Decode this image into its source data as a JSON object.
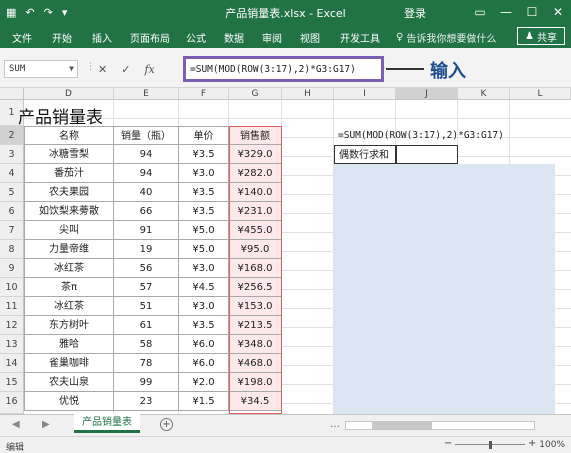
{
  "window": {
    "title": "产品销量表.xlsx - Excel",
    "login": "登录",
    "qat": [
      "▦",
      "↶",
      "↷",
      "▾"
    ],
    "controls": [
      "▭",
      "—",
      "☐",
      "✕"
    ]
  },
  "ribbon": {
    "tabs": [
      "文件",
      "开始",
      "插入",
      "页面布局",
      "公式",
      "数据",
      "审阅",
      "视图",
      "开发工具"
    ],
    "tell_me": "告诉我你想要做什么",
    "share": "共享"
  },
  "formula_bar": {
    "name_box": "SUM",
    "cancel": "✕",
    "enter": "✓",
    "fx": "fx",
    "formula": "=SUM(MOD(ROW(3:17),2)*G3:G17)"
  },
  "annotation": {
    "label": "输入"
  },
  "columns": [
    "D",
    "E",
    "F",
    "G",
    "H",
    "I",
    "J",
    "K",
    "L"
  ],
  "rows": [
    "1",
    "2",
    "3",
    "4",
    "5",
    "6",
    "7",
    "8",
    "9",
    "10",
    "11",
    "12",
    "13",
    "14",
    "15",
    "16"
  ],
  "sheet_title": "产品销量表",
  "table": {
    "headers": [
      "名称",
      "销量（瓶）",
      "单价",
      "销售额"
    ],
    "data": [
      [
        "冰糖雪梨",
        "94",
        "¥3.5",
        "¥329.0"
      ],
      [
        "番茄汁",
        "94",
        "¥3.0",
        "¥282.0"
      ],
      [
        "农夫果园",
        "40",
        "¥3.5",
        "¥140.0"
      ],
      [
        "如饮梨来蒡散",
        "66",
        "¥3.5",
        "¥231.0"
      ],
      [
        "尖叫",
        "91",
        "¥5.0",
        "¥455.0"
      ],
      [
        "力量帝维",
        "19",
        "¥5.0",
        "¥95.0"
      ],
      [
        "冰红茶",
        "56",
        "¥3.0",
        "¥168.0"
      ],
      [
        "茶π",
        "57",
        "¥4.5",
        "¥256.5"
      ],
      [
        "冰红茶",
        "51",
        "¥3.0",
        "¥153.0"
      ],
      [
        "东方树叶",
        "61",
        "¥3.5",
        "¥213.5"
      ],
      [
        "雅哈",
        "58",
        "¥6.0",
        "¥348.0"
      ],
      [
        "雀巢咖啡",
        "78",
        "¥6.0",
        "¥468.0"
      ],
      [
        "农夫山泉",
        "99",
        "¥2.0",
        "¥198.0"
      ],
      [
        "优悦",
        "23",
        "¥1.5",
        "¥34.5"
      ]
    ]
  },
  "side": {
    "formula_cell": "=SUM(MOD(ROW(3:17),2)*G3:G17)",
    "label_cell": "偶数行求和"
  },
  "sheet_tabs": {
    "active": "产品销量表",
    "add": "+",
    "nav_prev": "◀",
    "nav_next": "▶",
    "more": "…"
  },
  "status": {
    "mode": "编辑",
    "zoom": "100%",
    "minus": "−",
    "plus": "+"
  }
}
